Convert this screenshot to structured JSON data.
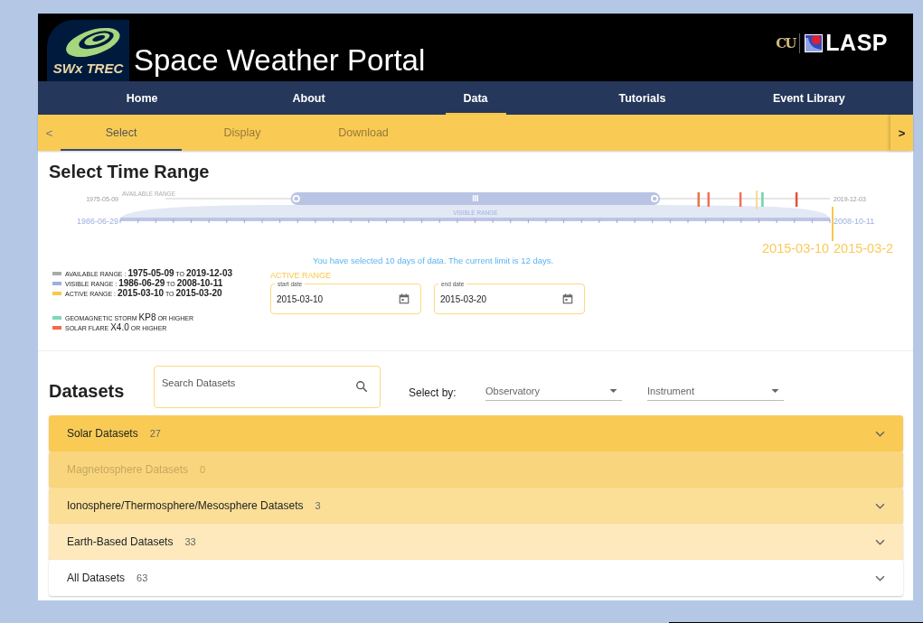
{
  "header": {
    "logo_text": "SWx TREC",
    "title": "Space Weather Portal",
    "partner_mark": "CU",
    "partner_logo_text": "LASP"
  },
  "nav": [
    {
      "label": "Home",
      "selected": false
    },
    {
      "label": "About",
      "selected": false
    },
    {
      "label": "Data",
      "selected": true
    },
    {
      "label": "Tutorials",
      "selected": false
    },
    {
      "label": "Event Library",
      "selected": false
    }
  ],
  "stepper": {
    "prev": "<",
    "next": ">",
    "steps": [
      {
        "label": "Select",
        "selected": true,
        "disabled": false
      },
      {
        "label": "Display",
        "selected": false,
        "disabled": true
      },
      {
        "label": "Download",
        "selected": false,
        "disabled": true
      }
    ]
  },
  "time_range": {
    "title": "Select Time Range",
    "timeline": {
      "available_start": "1975-05-09",
      "available_caption": "AVAILABLE RANGE",
      "available_end": "2019-12-03",
      "visible_start": "1986-06-29",
      "visible_caption": "VISIBLE RANGE",
      "visible_end": "2008-10-11",
      "handles": [
        {
          "level": 0.248
        },
        {
          "level": 0.753
        }
      ],
      "active_marker": {
        "level": 0.897
      },
      "events": [
        {
          "color": "#e8734a",
          "level": 0.815
        },
        {
          "color": "#f0705a",
          "level": 0.829
        },
        {
          "color": "#f0705a",
          "level": 0.874
        },
        {
          "color": "#6fd3b0",
          "level": 0.905
        },
        {
          "color": "#e0523a",
          "level": 0.953
        }
      ],
      "active_labels": [
        "2015-03-10",
        "2015-03-2"
      ]
    },
    "legend": [
      {
        "kind": "range",
        "color": "#aaaaaa",
        "text": "AVAILABLE RANGE : **1975-05-09** TO **2019-12-03**"
      },
      {
        "kind": "range",
        "color": "#9fb0e0",
        "text": "VISIBLE RANGE : **1986-06-29** TO **2008-10-11**"
      },
      {
        "kind": "range",
        "color": "#f9c74a",
        "text": "ACTIVE RANGE : **2015-03-10** TO **2015-03-20**"
      },
      {
        "kind": "event",
        "color": "#7fd8b8",
        "text": "GEOMAGNETIC STORM **KP8** OR HIGHER"
      },
      {
        "kind": "event",
        "color": "#f26b4a",
        "text": "SOLAR FLARE **X4.0** OR HIGHER"
      }
    ],
    "message": "You have selected 10 days of data. The current limit is 12 days.",
    "active_range_label": "ACTIVE RANGE",
    "fields": [
      {
        "label": "start date",
        "value": "2015-03-10"
      },
      {
        "label": "end date",
        "value": "2015-03-20"
      }
    ]
  },
  "datasets": {
    "title": "Datasets",
    "search": {
      "placeholder": "Search Datasets"
    },
    "select_by_label": "Select by:",
    "filters": [
      {
        "label": "Observatory"
      },
      {
        "label": "Instrument"
      }
    ],
    "categories": [
      {
        "label": "Solar Datasets",
        "count": "27",
        "color": "#f9cb55",
        "disabled": false
      },
      {
        "label": "Magnetosphere Datasets",
        "count": "0",
        "color": "#f9d67d",
        "disabled": true
      },
      {
        "label": "Ionosphere/Thermosphere/Mesosphere Datasets",
        "count": "3",
        "color": "#fbdf97",
        "disabled": false
      },
      {
        "label": "Earth-Based Datasets",
        "count": "33",
        "color": "#fde9bc",
        "disabled": false
      },
      {
        "label": "All Datasets",
        "count": "63",
        "color": "#ffffff",
        "disabled": false
      }
    ]
  }
}
